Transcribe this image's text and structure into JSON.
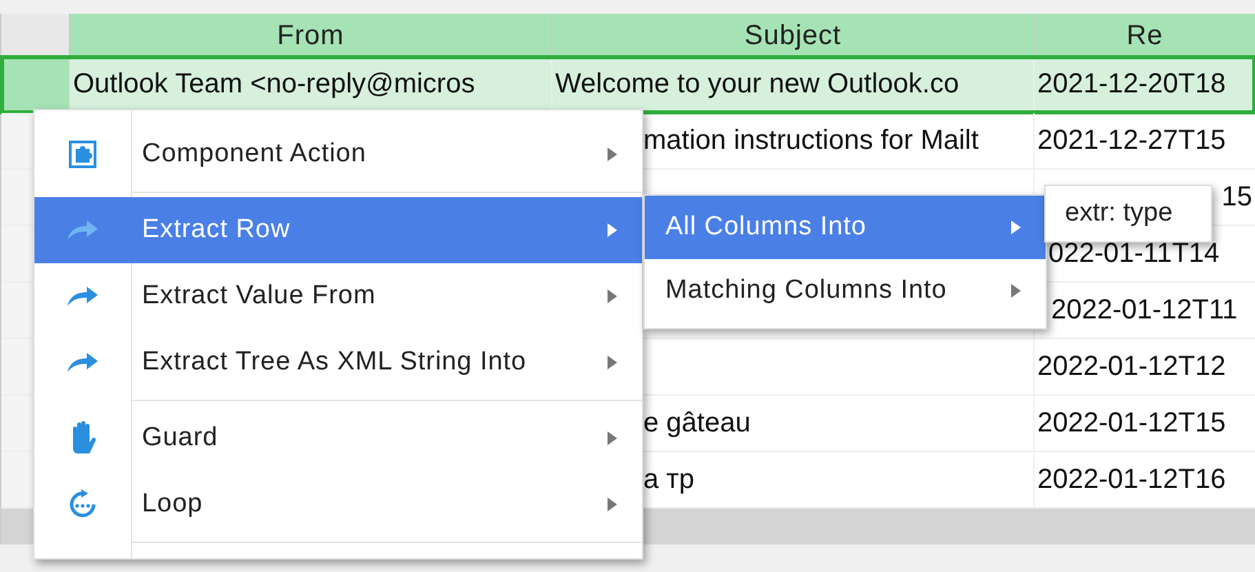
{
  "table": {
    "columns": [
      "From",
      "Subject",
      "Re"
    ],
    "rows": [
      {
        "selected": true,
        "cells": [
          "Outlook Team <no-reply@micros",
          "Welcome to your new Outlook.co",
          "2021-12-20T18"
        ]
      },
      {
        "selected": false,
        "cells": [
          "",
          "mation instructions for Mailt",
          "2021-12-27T15"
        ]
      },
      {
        "selected": false,
        "cells": [
          "",
          "",
          "15"
        ]
      },
      {
        "selected": false,
        "cells": [
          "",
          "",
          "022-01-11T14"
        ]
      },
      {
        "selected": false,
        "cells": [
          "",
          "",
          "2022-01-12T11"
        ]
      },
      {
        "selected": false,
        "cells": [
          "",
          "",
          "2022-01-12T12"
        ]
      },
      {
        "selected": false,
        "cells": [
          "",
          "e gâteau",
          "2022-01-12T15"
        ]
      },
      {
        "selected": false,
        "cells": [
          "",
          "a тр",
          "2022-01-12T16"
        ]
      }
    ]
  },
  "context_menu": {
    "items": [
      {
        "kind": "puzzle",
        "label": "Component Action",
        "selected": false,
        "submenu": true
      },
      {
        "kind": "arrow",
        "label": "Extract Row",
        "selected": true,
        "submenu": true
      },
      {
        "kind": "arrow",
        "label": "Extract Value From",
        "selected": false,
        "submenu": true
      },
      {
        "kind": "arrow",
        "label": "Extract Tree As XML String Into",
        "selected": false,
        "submenu": true
      },
      {
        "kind": "hand",
        "label": "Guard",
        "selected": false,
        "submenu": true
      },
      {
        "kind": "loop",
        "label": "Loop",
        "selected": false,
        "submenu": true
      }
    ]
  },
  "submenu": {
    "items": [
      {
        "label": "All Columns Into",
        "selected": true,
        "submenu": true
      },
      {
        "label": "Matching Columns Into",
        "selected": false,
        "submenu": true
      }
    ]
  },
  "sub_submenu": {
    "items": [
      {
        "label": "extr: type",
        "selected": false
      }
    ]
  }
}
